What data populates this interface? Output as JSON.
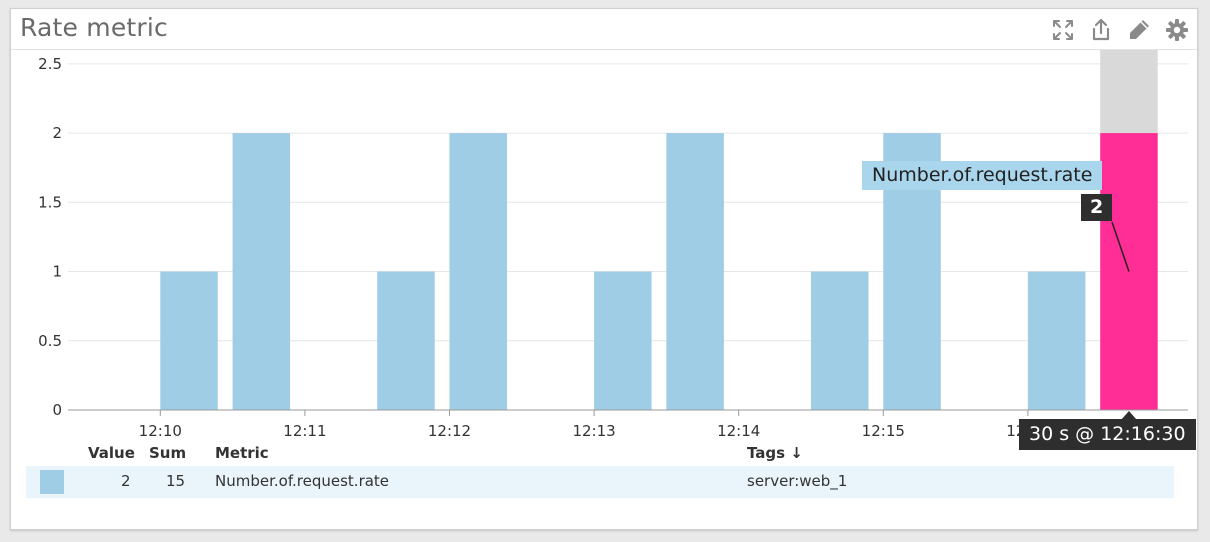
{
  "widget": {
    "title": "Rate metric",
    "icons": [
      "expand-icon",
      "share-icon",
      "pencil-icon",
      "gear-icon"
    ]
  },
  "colors": {
    "bar": "#9fcde6",
    "highlight": "#ff2e96",
    "highlight_cap": "#d9d9d9",
    "grid": "#e6e6e6",
    "axis": "#9a9a9a"
  },
  "chart_data": {
    "type": "bar",
    "series_name": "Number.of.request.rate",
    "x_ticks": [
      "12:10",
      "12:11",
      "12:12",
      "12:13",
      "12:14",
      "12:15",
      "12:16"
    ],
    "x": [
      "12:10:00",
      "12:10:30",
      "12:11:00",
      "12:11:30",
      "12:12:00",
      "12:12:30",
      "12:13:00",
      "12:13:30",
      "12:14:00",
      "12:14:30",
      "12:15:00",
      "12:15:30",
      "12:16:00",
      "12:16:30"
    ],
    "values": [
      1,
      2,
      0,
      1,
      2,
      0,
      1,
      2,
      0,
      1,
      2,
      0,
      1,
      2
    ],
    "y_ticks": [
      "0",
      "0.5",
      "1",
      "1.5",
      "2",
      "2.5"
    ],
    "ylim": [
      0,
      2.6
    ],
    "grid": true,
    "highlight_index": 13
  },
  "tooltip": {
    "series": "Number.of.request.rate",
    "value": "2",
    "time": "30 s @ 12:16:30"
  },
  "legend": {
    "headers": {
      "value": "Value",
      "sum": "Sum",
      "metric": "Metric",
      "tags": "Tags ↓"
    },
    "rows": [
      {
        "value": "2",
        "sum": "15",
        "metric": "Number.of.request.rate",
        "tags": "server:web_1"
      }
    ]
  }
}
